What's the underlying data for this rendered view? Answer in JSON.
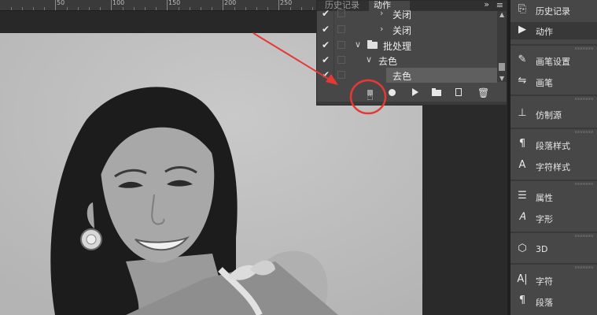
{
  "ruler": {
    "numbers": [
      "50",
      "100",
      "150",
      "200",
      "250"
    ]
  },
  "actions_panel": {
    "tabs": [
      "历史记录",
      "动作"
    ],
    "menu_glyph": "»",
    "rows": [
      {
        "checked": true,
        "label": "关闭",
        "arrow": "›",
        "indent": "step"
      },
      {
        "checked": true,
        "label": "关闭",
        "arrow": "›",
        "indent": "step"
      },
      {
        "checked": true,
        "label": "批处理",
        "arrow": "∨",
        "indent": "set",
        "folder": true
      },
      {
        "checked": true,
        "label": "去色",
        "arrow": "∨",
        "indent": "action"
      },
      {
        "checked": true,
        "label": "去色",
        "arrow": "",
        "indent": "step",
        "selected": true
      }
    ],
    "toolbar": [
      "stop-recording",
      "record",
      "play",
      "new-set",
      "new-action",
      "delete"
    ]
  },
  "right_dock": {
    "items": [
      {
        "icon": "history-icon",
        "glyph": "⎘",
        "label": "历史记录"
      },
      {
        "icon": "play-icon",
        "glyph": "▶",
        "label": "动作",
        "active": true
      },
      {
        "icon": "brush-settings-icon",
        "glyph": "✎",
        "label": "画笔设置"
      },
      {
        "icon": "brushes-icon",
        "glyph": "⇋",
        "label": "画笔"
      },
      {
        "icon": "clone-source-icon",
        "glyph": "⊥",
        "label": "仿制源"
      },
      {
        "icon": "paragraph-styles-icon",
        "glyph": "¶",
        "label": "段落样式"
      },
      {
        "icon": "character-styles-icon",
        "glyph": "A",
        "label": "字符样式"
      },
      {
        "icon": "properties-icon",
        "glyph": "☰",
        "label": "属性"
      },
      {
        "icon": "glyphs-icon",
        "glyph": "𝐴",
        "label": "字形"
      },
      {
        "icon": "3d-icon",
        "glyph": "⬡",
        "label": "3D"
      },
      {
        "icon": "character-icon",
        "glyph": "A|",
        "label": "字符"
      },
      {
        "icon": "paragraph-icon",
        "glyph": "¶",
        "label": "段落"
      }
    ]
  },
  "colors": {
    "annotation": "#e53935",
    "panel": "#474747",
    "dock": "#474747"
  }
}
